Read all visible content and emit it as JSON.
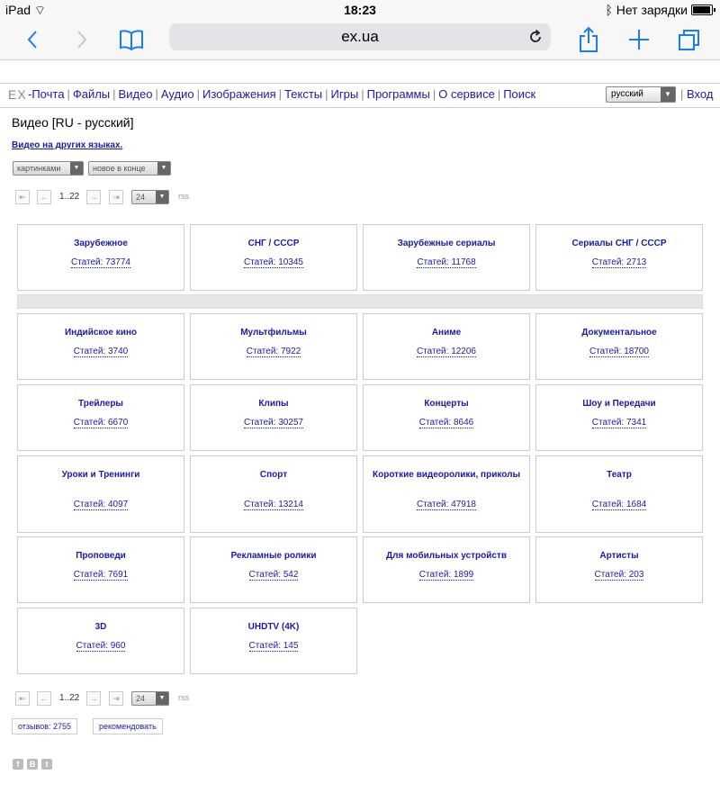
{
  "status_bar": {
    "device": "iPad",
    "time": "18:23",
    "charge": "Нет зарядки"
  },
  "browser": {
    "url": "ex.ua"
  },
  "nav": {
    "logo": "EX",
    "links": [
      "-Почта",
      "Файлы",
      "Видео",
      "Аудио",
      "Изображения",
      "Тексты",
      "Игры",
      "Программы",
      "О сервисе",
      "Поиск"
    ],
    "language": "русский",
    "login": "Вход"
  },
  "page": {
    "title": "Видео [RU - русский]",
    "other_languages": "Видео на других языках.",
    "view_select": "картинками",
    "sort_select": "новое в конце",
    "pages": "1..22",
    "per_page": "24",
    "rss": "rss"
  },
  "categories": [
    {
      "title": "Зарубежное",
      "count": "Статей: 73774"
    },
    {
      "title": "СНГ / СССР",
      "count": "Статей: 10345"
    },
    {
      "title": "Зарубежные сериалы",
      "count": "Статей: 11768"
    },
    {
      "title": "Сериалы СНГ / СССР",
      "count": "Статей: 2713"
    },
    {
      "title": "Индийское кино",
      "count": "Статей: 3740"
    },
    {
      "title": "Мультфильмы",
      "count": "Статей: 7922"
    },
    {
      "title": "Аниме",
      "count": "Статей: 12206"
    },
    {
      "title": "Документальное",
      "count": "Статей: 18700"
    },
    {
      "title": "Трейлеры",
      "count": "Статей: 6670"
    },
    {
      "title": "Клипы",
      "count": "Статей: 30257"
    },
    {
      "title": "Концерты",
      "count": "Статей: 8646"
    },
    {
      "title": "Шоу и Передачи",
      "count": "Статей: 7341"
    },
    {
      "title": "Уроки и Тренинги",
      "count": "Статей: 4097"
    },
    {
      "title": "Спорт",
      "count": "Статей: 13214"
    },
    {
      "title": "Короткие видеоролики, приколы",
      "count": "Статей: 47918"
    },
    {
      "title": "Театр",
      "count": "Статей: 1684"
    },
    {
      "title": "Проповеди",
      "count": "Статей: 7691"
    },
    {
      "title": "Рекламные ролики",
      "count": "Статей: 542"
    },
    {
      "title": "Для мобильных устройств",
      "count": "Статей: 1899"
    },
    {
      "title": "Артисты",
      "count": "Статей: 203"
    },
    {
      "title": "3D",
      "count": "Статей: 960"
    },
    {
      "title": "UHDTV (4K)",
      "count": "Статей: 145"
    }
  ],
  "footer": {
    "reviews": "отзывов: 2755",
    "recommend": "рекомендовать"
  },
  "social": [
    "f",
    "B",
    "t"
  ]
}
